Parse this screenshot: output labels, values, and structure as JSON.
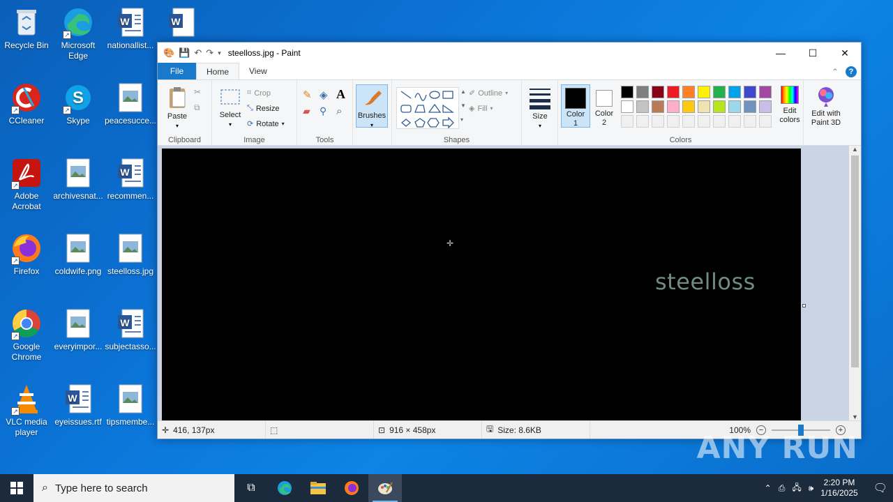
{
  "desktop": {
    "icons": [
      {
        "label": "Recycle Bin"
      },
      {
        "label": "Microsoft Edge"
      },
      {
        "label": "nationallist..."
      },
      {
        "label": ""
      },
      {
        "label": "CCleaner"
      },
      {
        "label": "Skype"
      },
      {
        "label": "peacesucce..."
      },
      {
        "label": "Adobe Acrobat"
      },
      {
        "label": "archivesnat..."
      },
      {
        "label": "recommen..."
      },
      {
        "label": "Firefox"
      },
      {
        "label": "coldwife.png"
      },
      {
        "label": "steelloss.jpg"
      },
      {
        "label": "Google Chrome"
      },
      {
        "label": "everyimpor..."
      },
      {
        "label": "subjectasso..."
      },
      {
        "label": "VLC media player"
      },
      {
        "label": "eyeissues.rtf"
      },
      {
        "label": "tipsmembe..."
      }
    ]
  },
  "paint": {
    "title": "steelloss.jpg - Paint",
    "tabs": {
      "file": "File",
      "home": "Home",
      "view": "View"
    },
    "help": "?",
    "clipboard": {
      "paste": "Paste",
      "group": "Clipboard"
    },
    "image": {
      "select": "Select",
      "crop": "Crop",
      "resize": "Resize",
      "rotate": "Rotate",
      "group": "Image"
    },
    "tools": {
      "group": "Tools",
      "text_tool": "A"
    },
    "brushes": {
      "label": "Brushes"
    },
    "shapes": {
      "outline": "Outline",
      "fill": "Fill",
      "group": "Shapes"
    },
    "size": {
      "label": "Size"
    },
    "colors": {
      "color1": "Color 1",
      "color2": "Color 2",
      "edit": "Edit colors",
      "group": "Colors",
      "palette_row1": [
        "#000000",
        "#7f7f7f",
        "#880015",
        "#ed1c24",
        "#ff7f27",
        "#fff200",
        "#22b14c",
        "#00a2e8",
        "#3f48cc",
        "#a349a4"
      ],
      "palette_row2": [
        "#ffffff",
        "#c3c3c3",
        "#b97a57",
        "#ffaec9",
        "#ffc90e",
        "#efe4b0",
        "#b5e61d",
        "#99d9ea",
        "#7092be",
        "#c8bfe7"
      ]
    },
    "paint3d": {
      "label": "Edit with Paint 3D"
    },
    "canvas_text": "steelloss",
    "status": {
      "cursor": "416, 137px",
      "dimensions": "916 × 458px",
      "size": "Size: 8.6KB",
      "zoom": "100%"
    }
  },
  "taskbar": {
    "search_placeholder": "Type here to search",
    "time": "2:20 PM",
    "date": "1/16/2025"
  },
  "watermark": "ANY RUN"
}
